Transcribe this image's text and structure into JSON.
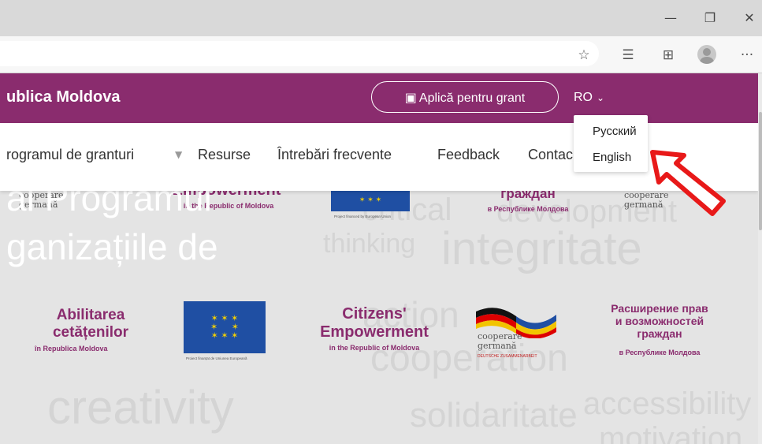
{
  "browser": {
    "window_controls": {
      "minimize": "—",
      "restore": "❐",
      "close": "✕"
    },
    "toolbar_icons": [
      "star-icon",
      "favorites-icon",
      "collections-icon",
      "profile-avatar",
      "more-icon"
    ],
    "more_glyph": "···"
  },
  "header": {
    "brand": "ublica Moldova",
    "apply_button": "Aplică pentru grant",
    "language": "RO",
    "accent_color": "#8a2c6e"
  },
  "language_menu": {
    "items": [
      "Русский",
      "English"
    ]
  },
  "nav": {
    "items": [
      "rogramul de granturi",
      "Resurse",
      "Întrebări frecvente",
      "Feedback",
      "Contac"
    ]
  },
  "hero": {
    "title_line1": "al Programul",
    "title_line2": "ganizațiile de",
    "background_words": [
      "critical",
      "development",
      "thinking",
      "integritate",
      "solidaritate",
      "accessibility",
      "cooperation",
      "motivation",
      "creativity",
      "action"
    ]
  },
  "logos": {
    "row1": {
      "empowerment": "Empowerment",
      "empowerment_sub": "in the Republic of Moldova",
      "cooperare": "cooperare",
      "germana": "germană",
      "eu_caption": "Project financed by European Union",
      "grajdan": "граждан",
      "grajdan_sub": "в Республике Молдова"
    },
    "row2": {
      "abilitarea_l1": "Abilitarea",
      "abilitarea_l2": "cetățenilor",
      "abilitarea_sub": "în Republica Moldova",
      "eu_caption": "Proiect finanțat de Uniunea Europeană",
      "citizens_l1": "Citizens'",
      "citizens_l2": "Empowerment",
      "citizens_sub": "in the Republic of Moldova",
      "cooperare": "cooperare",
      "germana": "germană",
      "deutsche": "DEUTSCHE ZUSAMMENARBEIT",
      "rasshirenie_l1": "Расширение прав",
      "rasshirenie_l2": "и возможностей",
      "rasshirenie_l3": "граждан",
      "rasshirenie_sub": "в Республике Молдова"
    }
  }
}
